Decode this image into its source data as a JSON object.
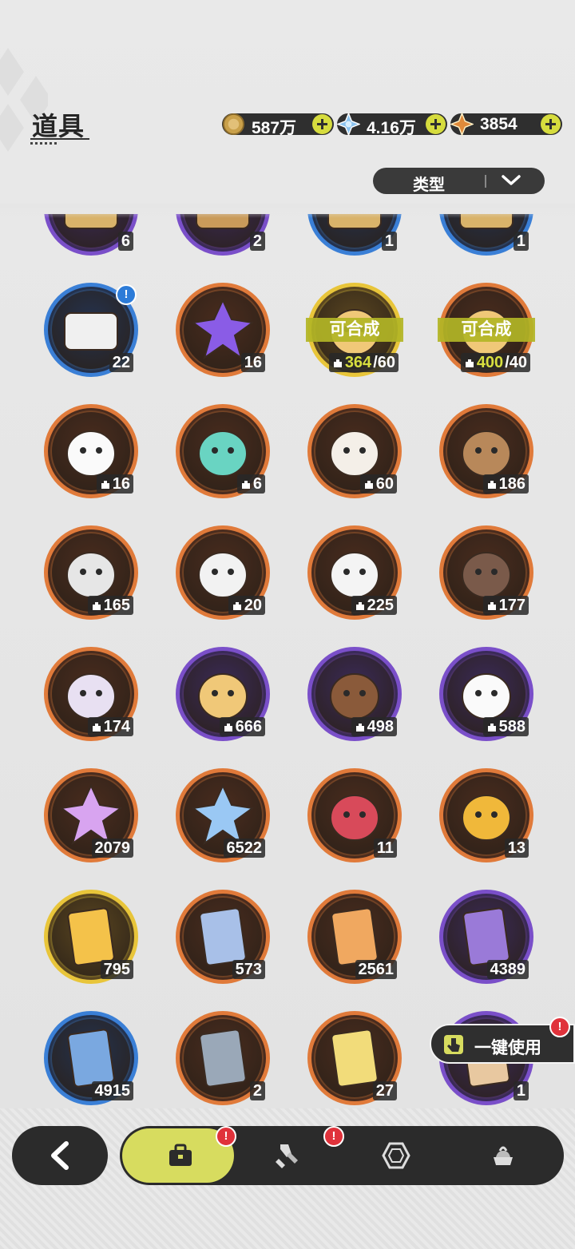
{
  "header": {
    "title": "道具"
  },
  "currencies": [
    {
      "name": "gold-coin",
      "value": "587万",
      "color": "#c9a04a"
    },
    {
      "name": "crystal",
      "value": "4.16万",
      "color": "#7fb7e8"
    },
    {
      "name": "star-gem",
      "value": "3854",
      "color": "#e08a3a"
    }
  ],
  "filter": {
    "label": "类型"
  },
  "rows": [
    {
      "items": [
        {
          "icon": "chest-icon",
          "rarity": "purple",
          "count": "6"
        },
        {
          "icon": "map-chest-icon",
          "rarity": "purple",
          "count": "2"
        },
        {
          "icon": "chest-icon",
          "rarity": "blue",
          "count": "1"
        },
        {
          "icon": "chest-icon",
          "rarity": "blue",
          "count": "1"
        }
      ]
    },
    {
      "items": [
        {
          "icon": "treasure-chest-icon",
          "rarity": "blue",
          "count": "22",
          "info": "!"
        },
        {
          "icon": "purple-crystal-icon",
          "rarity": "orange",
          "count": "16"
        },
        {
          "icon": "hamster-icon",
          "rarity": "yellow",
          "synth": "可合成",
          "have": "364",
          "need": "/60"
        },
        {
          "icon": "hamster-icon",
          "rarity": "orange",
          "synth": "可合成",
          "have": "400",
          "need": "/40"
        }
      ]
    },
    {
      "items": [
        {
          "icon": "chick-icon",
          "rarity": "orange",
          "count": "16",
          "frag": true
        },
        {
          "icon": "penguin-icon",
          "rarity": "orange",
          "count": "6",
          "frag": true
        },
        {
          "icon": "fox-icon",
          "rarity": "orange",
          "count": "60",
          "frag": true
        },
        {
          "icon": "bear-icon",
          "rarity": "orange",
          "count": "186",
          "frag": true
        }
      ]
    },
    {
      "items": [
        {
          "icon": "knight-icon",
          "rarity": "orange",
          "count": "165",
          "frag": true
        },
        {
          "icon": "polar-bear-icon",
          "rarity": "orange",
          "count": "20",
          "frag": true
        },
        {
          "icon": "tiger-icon",
          "rarity": "orange",
          "count": "225",
          "frag": true
        },
        {
          "icon": "pirate-bear-icon",
          "rarity": "orange",
          "count": "177",
          "frag": true
        }
      ]
    },
    {
      "items": [
        {
          "icon": "cat-icon",
          "rarity": "orange",
          "count": "174",
          "frag": true
        },
        {
          "icon": "hamster-icon",
          "rarity": "purple",
          "count": "666",
          "frag": true
        },
        {
          "icon": "boar-icon",
          "rarity": "purple",
          "count": "498",
          "frag": true
        },
        {
          "icon": "chick-icon",
          "rarity": "purple",
          "count": "588",
          "frag": true
        }
      ]
    },
    {
      "items": [
        {
          "icon": "pink-star-crystal-icon",
          "rarity": "orange",
          "count": "2079"
        },
        {
          "icon": "blue-star-crystal-icon",
          "rarity": "orange",
          "count": "6522"
        },
        {
          "icon": "red-paw-charm-icon",
          "rarity": "orange",
          "count": "11"
        },
        {
          "icon": "gold-paw-charm-icon",
          "rarity": "orange",
          "count": "13"
        }
      ]
    },
    {
      "items": [
        {
          "icon": "gold-card-icon",
          "rarity": "yellow",
          "count": "795"
        },
        {
          "icon": "rainbow-card-icon",
          "rarity": "orange",
          "count": "573"
        },
        {
          "icon": "orange-card-icon",
          "rarity": "orange",
          "count": "2561"
        },
        {
          "icon": "purple-card-icon",
          "rarity": "purple",
          "count": "4389"
        }
      ]
    },
    {
      "items": [
        {
          "icon": "blue-card-icon",
          "rarity": "blue",
          "count": "4915"
        },
        {
          "icon": "silver-card-icon",
          "rarity": "orange",
          "count": "2"
        },
        {
          "icon": "clover-card-icon",
          "rarity": "orange",
          "count": "27"
        },
        {
          "icon": "scroll-icon",
          "rarity": "purple",
          "count": "1"
        }
      ]
    }
  ],
  "onekey": {
    "label": "一键使用",
    "badge": "!"
  },
  "nav": {
    "tabs": [
      {
        "name": "bag-icon",
        "active": true,
        "badge": "!"
      },
      {
        "name": "equipment-icon",
        "active": false,
        "badge": "!"
      },
      {
        "name": "gem-icon",
        "active": false
      },
      {
        "name": "dessert-icon",
        "active": false
      }
    ]
  },
  "colors": {
    "purple": "#7a4fc9",
    "blue": "#3a7fd6",
    "orange": "#e07a3a",
    "yellow": "#e8c53a",
    "accent": "#d7dc5f"
  }
}
